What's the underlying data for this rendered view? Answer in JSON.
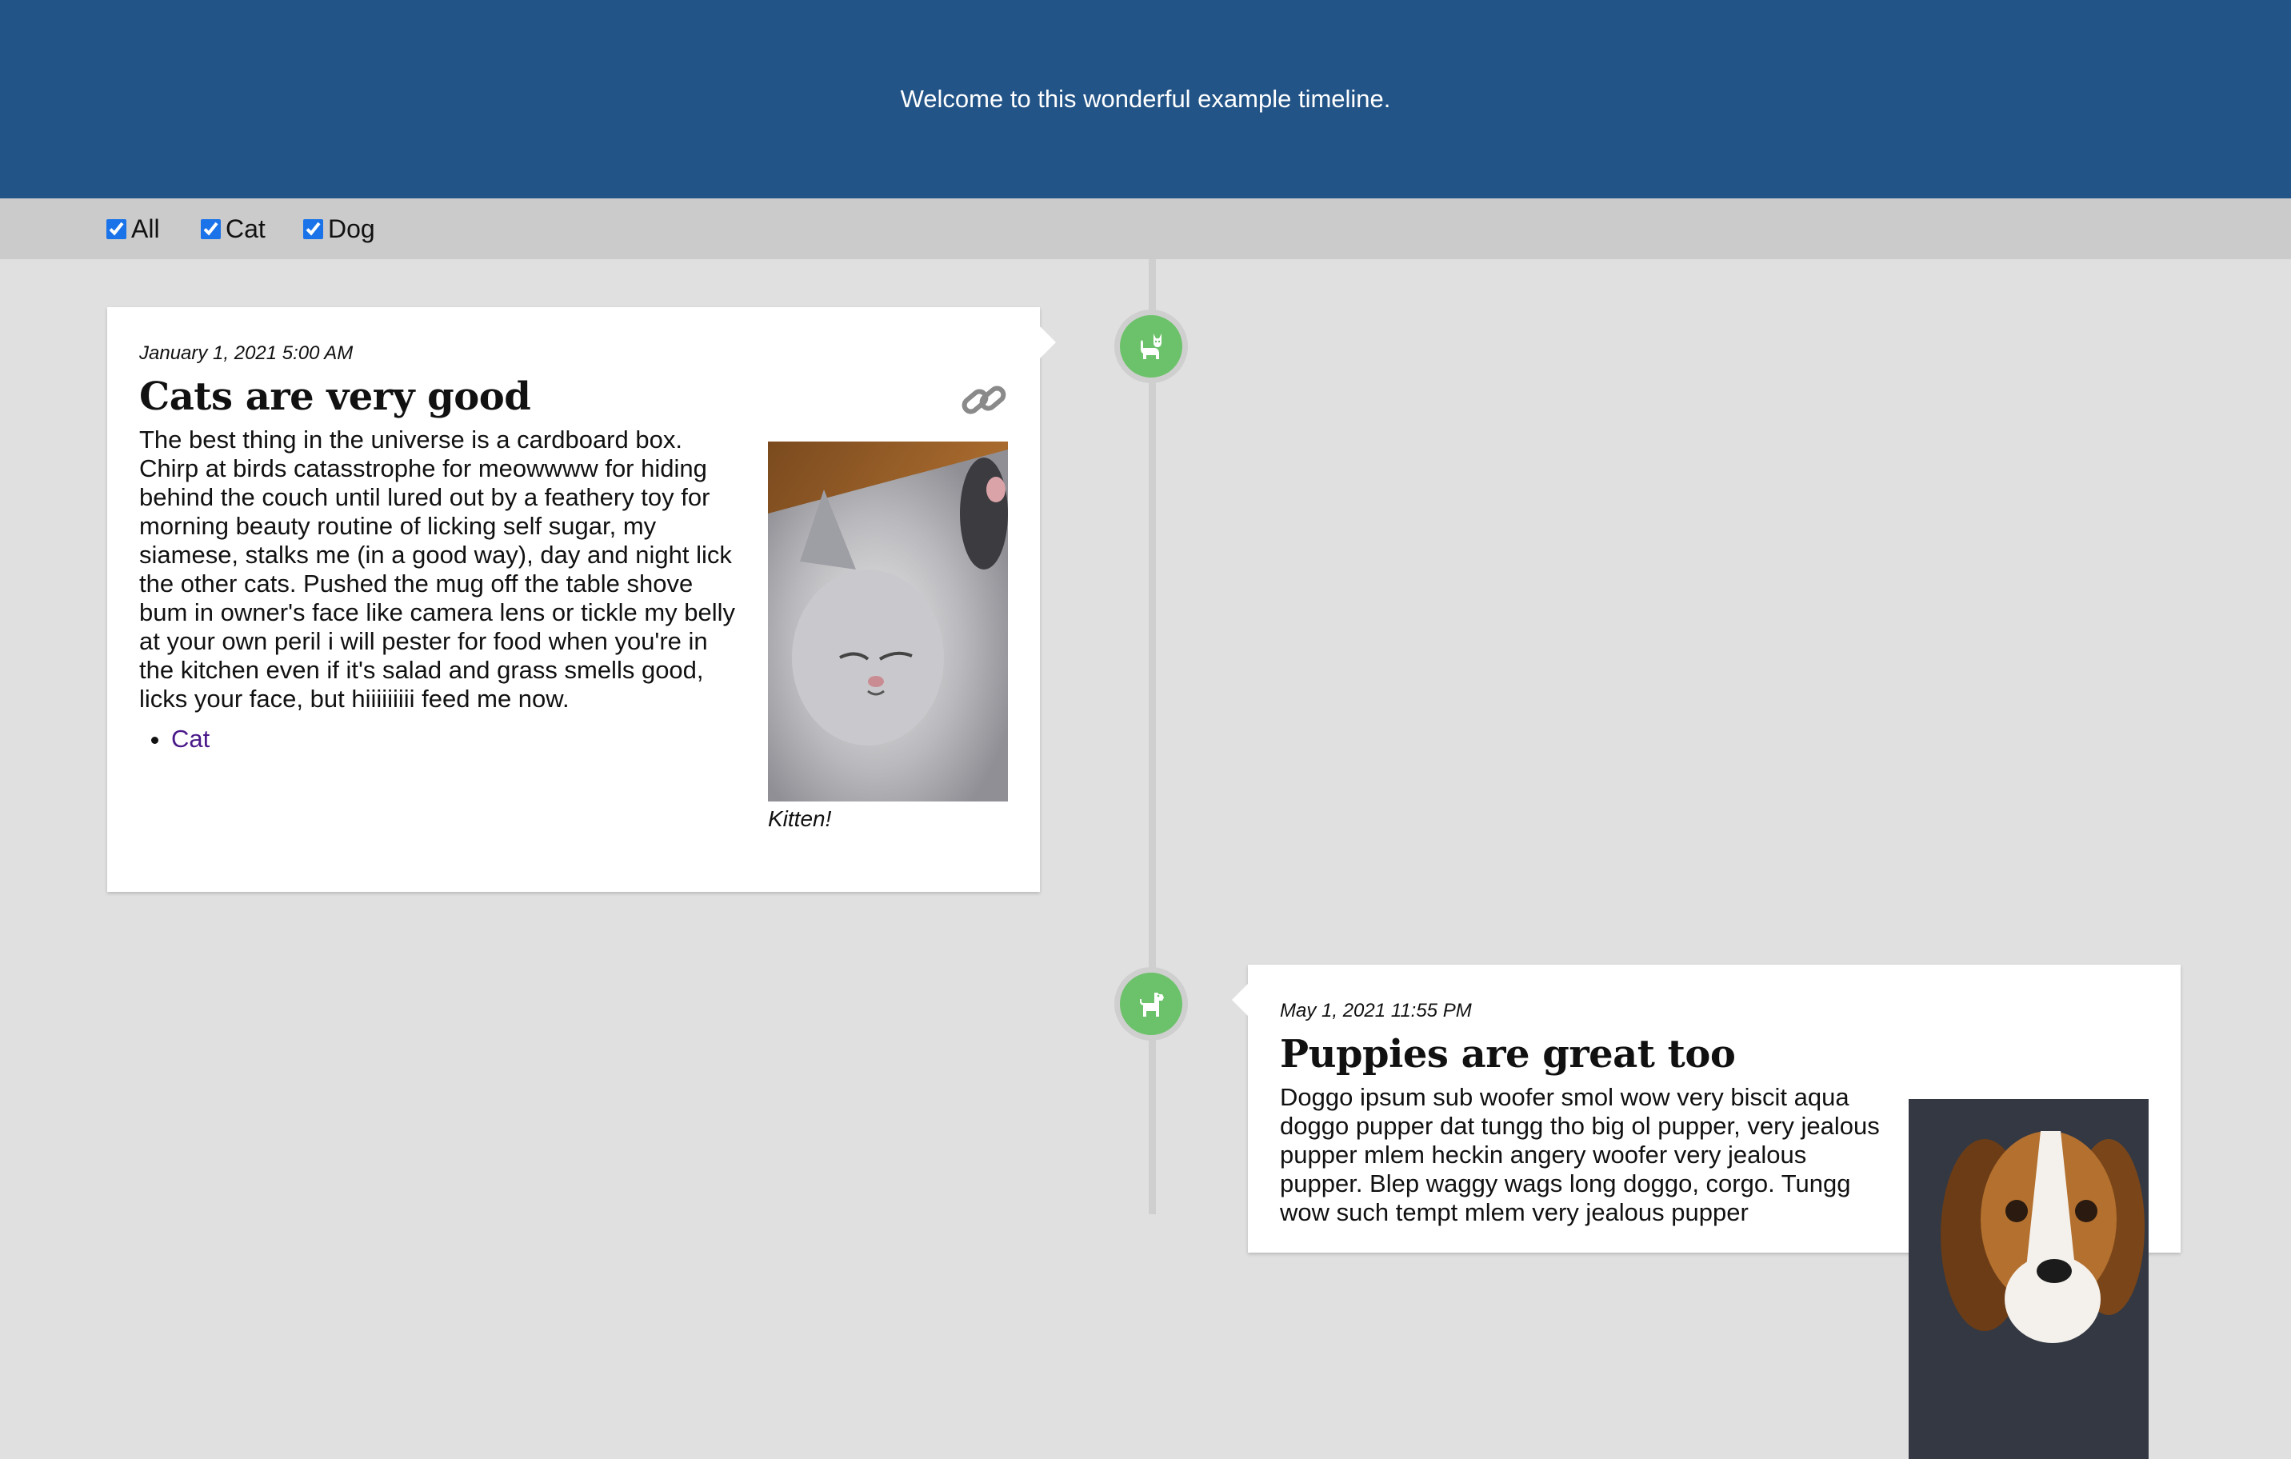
{
  "header": {
    "welcome": "Welcome to this wonderful example timeline."
  },
  "filters": [
    {
      "label": "All",
      "checked": true
    },
    {
      "label": "Cat",
      "checked": true
    },
    {
      "label": "Dog",
      "checked": true
    }
  ],
  "entries": [
    {
      "category": "Cat",
      "icon": "cat-icon",
      "date": "January 1, 2021 5:00 AM",
      "title": "Cats are very good",
      "body": "The best thing in the universe is a cardboard box. Chirp at birds catasstrophe for meowwww for hiding behind the couch until lured out by a feathery toy for morning beauty routine of licking self sugar, my siamese, stalks me (in a good way), day and night lick the other cats. Pushed the mug off the table shove bum in owner's face like camera lens or tickle my belly at your own peril i will pester for food when you're in the kitchen even if it's salad and grass smells good, licks your face, but hiiiiiiiii feed me now.",
      "tags": [
        "Cat"
      ],
      "image_caption": "Kitten!",
      "image_subject": "kitten-photo"
    },
    {
      "category": "Dog",
      "icon": "dog-icon",
      "date": "May 1, 2021 11:55 PM",
      "title": "Puppies are great too",
      "body": "Doggo ipsum sub woofer smol wow very biscit aqua doggo pupper dat tungg tho big ol pupper, very jealous pupper mlem heckin angery woofer very jealous pupper. Blep waggy wags long doggo, corgo. Tungg wow such tempt mlem very jealous pupper",
      "image_subject": "beagle-photo"
    }
  ],
  "colors": {
    "header_bg": "#235487",
    "marker_green": "#6cc26a",
    "tag_link": "#4b1a8a",
    "page_bg": "#e0e0e0",
    "filter_bar_bg": "#cbcbcb"
  }
}
